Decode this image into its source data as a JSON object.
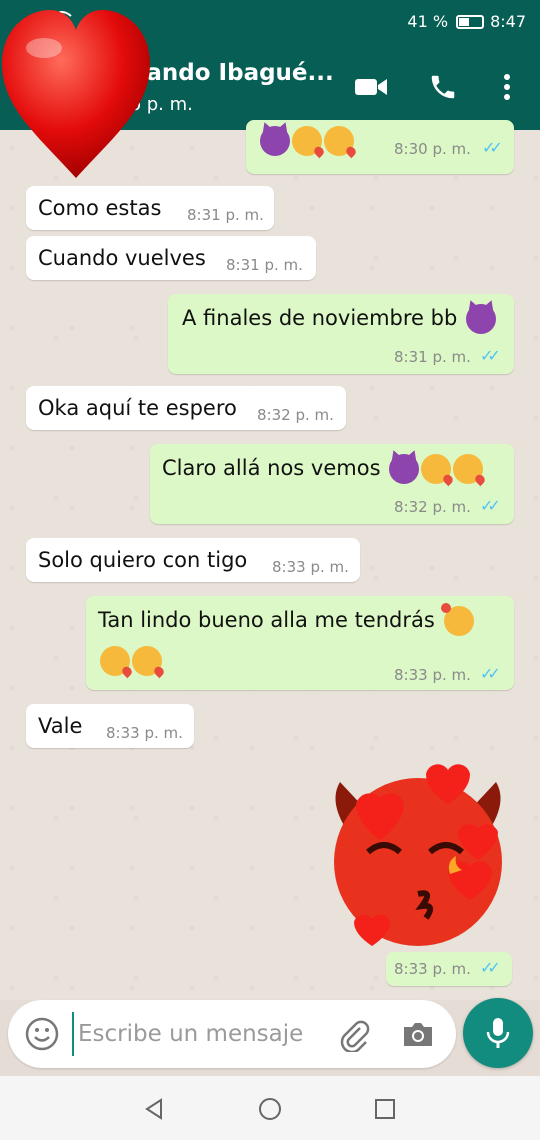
{
  "status_bar": {
    "battery": "41 %",
    "time": "8:47"
  },
  "header": {
    "contact_name": "nando Ibagué...",
    "last_seen": "o p. m."
  },
  "messages": [
    {
      "direction": "out",
      "text": "",
      "time": "8:30 p. m."
    },
    {
      "direction": "in",
      "text": "Como estas",
      "time": "8:31 p. m."
    },
    {
      "direction": "in",
      "text": "Cuando vuelves",
      "time": "8:31 p. m."
    },
    {
      "direction": "out",
      "text": "A finales de noviembre bb",
      "time": "8:31 p. m."
    },
    {
      "direction": "in",
      "text": "Oka aquí te espero",
      "time": "8:32 p. m."
    },
    {
      "direction": "out",
      "text": "Claro allá nos vemos",
      "time": "8:32 p. m."
    },
    {
      "direction": "in",
      "text": "Solo quiero con tigo",
      "time": "8:33 p. m."
    },
    {
      "direction": "out",
      "text": "Tan lindo bueno alla me tendrás",
      "time": "8:33 p. m."
    },
    {
      "direction": "in",
      "text": "Vale",
      "time": "8:33 p. m."
    },
    {
      "direction": "out",
      "text": "",
      "time": "8:33 p. m."
    }
  ],
  "composer": {
    "placeholder": "Escribe un mensaje"
  },
  "colors": {
    "header": "#075e54",
    "accent": "#128c7e",
    "outgoing": "#dcf8c6",
    "incoming": "#ffffff",
    "read_ticks": "#4fc3f7"
  },
  "icons": [
    "wifi-icon",
    "battery-icon",
    "video-call-icon",
    "phone-icon",
    "more-options-icon",
    "emoji-icon",
    "attach-icon",
    "camera-icon",
    "mic-icon",
    "back-nav-icon",
    "home-nav-icon",
    "recents-nav-icon"
  ]
}
